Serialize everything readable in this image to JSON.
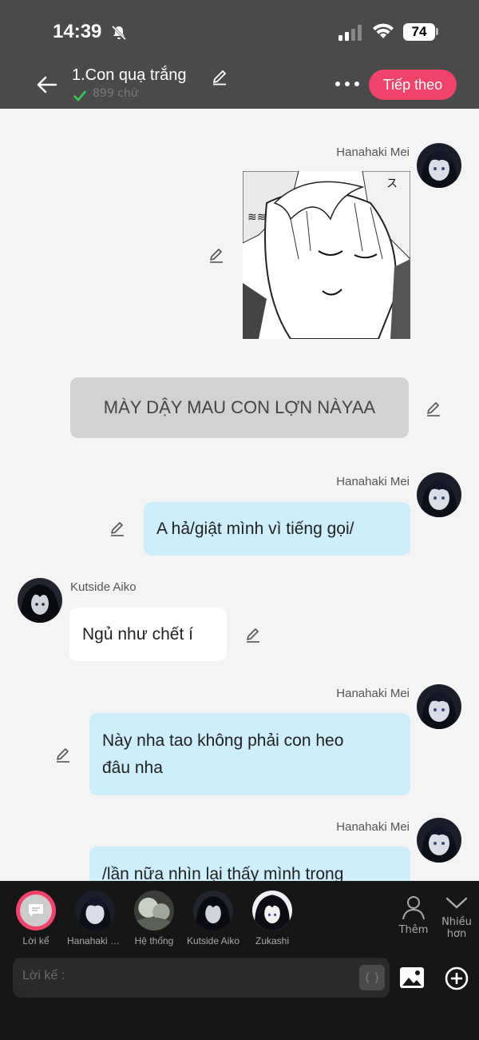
{
  "status": {
    "time": "14:39",
    "battery": "74"
  },
  "header": {
    "title": "1.Con quạ trắng",
    "word_count": "899 chữ",
    "next_label": "Tiếp theo"
  },
  "messages": [
    {
      "sender": "Hanahaki Mei",
      "side": "right",
      "type": "image"
    },
    {
      "sender": "",
      "side": "center",
      "type": "narration",
      "text": "MÀY DẬY MAU CON LỢN NÀYAA"
    },
    {
      "sender": "Hanahaki Mei",
      "side": "right",
      "type": "text",
      "text": "A hả/giật mình vì tiếng gọi/"
    },
    {
      "sender": "Kutside Aiko",
      "side": "left",
      "type": "text",
      "text": "Ngủ như chết í"
    },
    {
      "sender": "Hanahaki Mei",
      "side": "right",
      "type": "text",
      "text_line1": "Này nha tao không phải con heo",
      "text_line2": "đâu nha"
    },
    {
      "sender": "Hanahaki Mei",
      "side": "right",
      "type": "text",
      "text": "/lần nữa nhìn lại thấy mình trong"
    }
  ],
  "characters": [
    {
      "label": "Lời kể"
    },
    {
      "label": "Hanahaki Mei"
    },
    {
      "label": "Hệ thống"
    },
    {
      "label": "Kutside Aiko"
    },
    {
      "label": "Zukashi"
    }
  ],
  "actions": {
    "add_label": "Thêm",
    "more_label_1": "Nhiều",
    "more_label_2": "hơn"
  },
  "input": {
    "placeholder": "Lời kể :"
  },
  "colors": {
    "accent": "#f0436a",
    "bubble_blue": "#cdeefb",
    "narration_gray": "#d2d2d2"
  }
}
